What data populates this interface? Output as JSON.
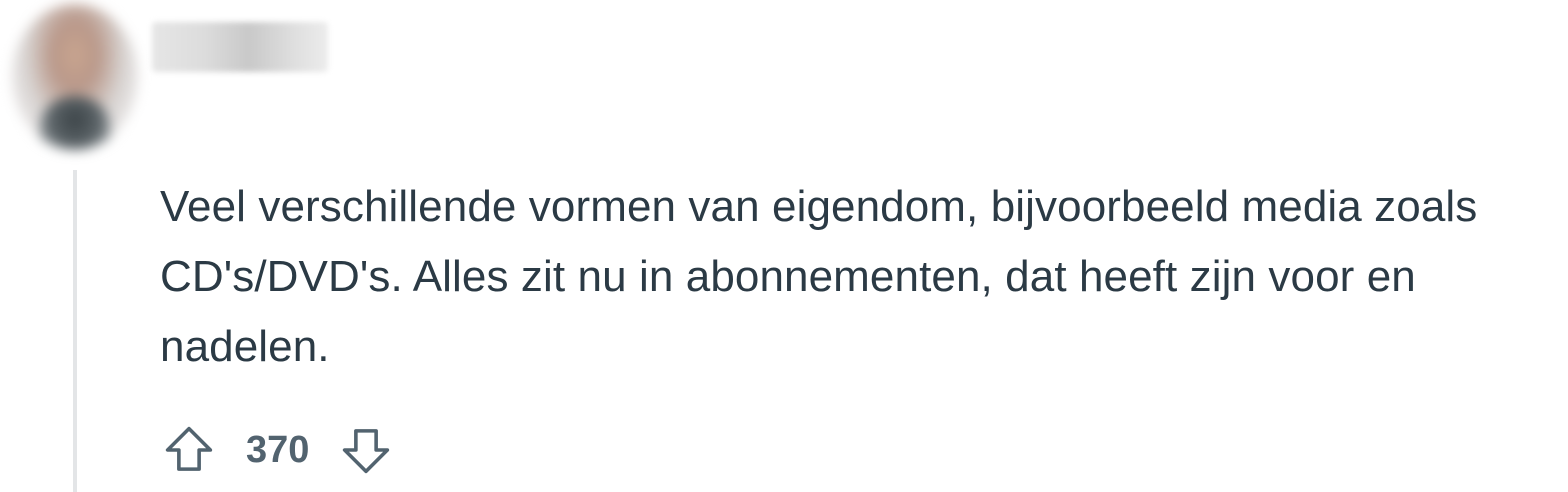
{
  "comment": {
    "author": "",
    "text": "Veel verschillende vormen van eigendom, bijvoorbeeld media zoals CD's/DVD's. Alles zit nu in abonnementen, dat heeft zijn voor en nadelen.",
    "score": "370"
  },
  "icons": {
    "upvote": "arrow-up-outline-icon",
    "downvote": "arrow-down-outline-icon"
  },
  "colors": {
    "text": "#2b3a45",
    "score": "#52636f",
    "thread_line": "#e3e5e7"
  }
}
